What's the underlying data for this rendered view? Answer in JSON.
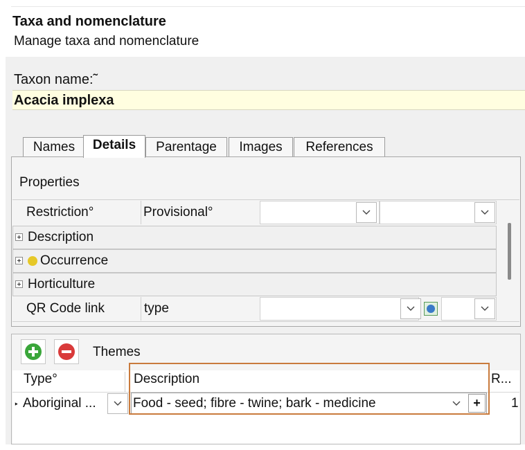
{
  "header": {
    "title": "Taxa and nomenclature",
    "subtitle": "Manage taxa and nomenclature"
  },
  "taxon": {
    "label": "Taxon name:˜",
    "value": "Acacia implexa"
  },
  "tabs": [
    {
      "label": "Names",
      "active": false
    },
    {
      "label": "Details",
      "active": true
    },
    {
      "label": "Parentage",
      "active": false
    },
    {
      "label": "Images",
      "active": false
    },
    {
      "label": "References",
      "active": false
    }
  ],
  "properties": {
    "title": "Properties",
    "restriction_label": "Restriction°",
    "provisional_label": "Provisional°",
    "groups": [
      {
        "label": "Description"
      },
      {
        "label": "Occurrence"
      },
      {
        "label": "Horticulture"
      }
    ],
    "qr_label": "QR Code link",
    "qr_type": "type"
  },
  "themes": {
    "title": "Themes",
    "columns": {
      "type": "Type°",
      "description": "Description",
      "r": "R..."
    },
    "row": {
      "marker": "‣",
      "type": "Aboriginal ...",
      "description": "Food - seed; fibre - twine; bark - medicine",
      "plus": "+",
      "r": "1"
    }
  },
  "colors": {
    "accent_highlight": "#c97a3c",
    "add_button": "#3aa63a",
    "remove_button": "#d93a3a",
    "occurrence_dot": "#e6c828",
    "taxon_field_bg": "#fffee0"
  }
}
